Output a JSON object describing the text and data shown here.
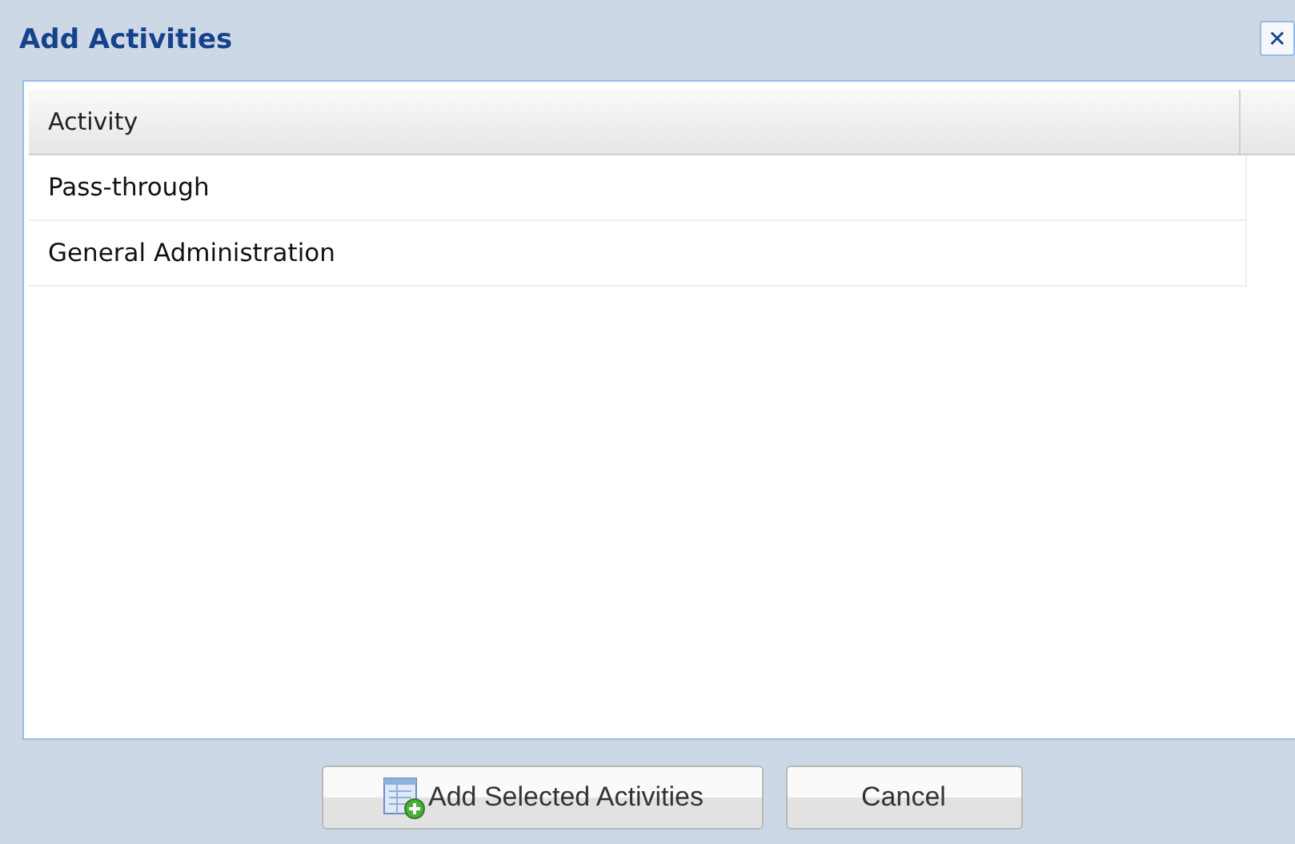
{
  "window": {
    "title": "Add Activities",
    "close_label": "✕"
  },
  "table": {
    "columns": [
      "Activity"
    ],
    "rows": [
      {
        "cells": [
          "Pass-through"
        ]
      },
      {
        "cells": [
          "General Administration"
        ]
      }
    ]
  },
  "buttons": [
    {
      "label": "Add Selected Activities",
      "kind": "add"
    },
    {
      "label": "Cancel",
      "kind": "plain"
    }
  ]
}
